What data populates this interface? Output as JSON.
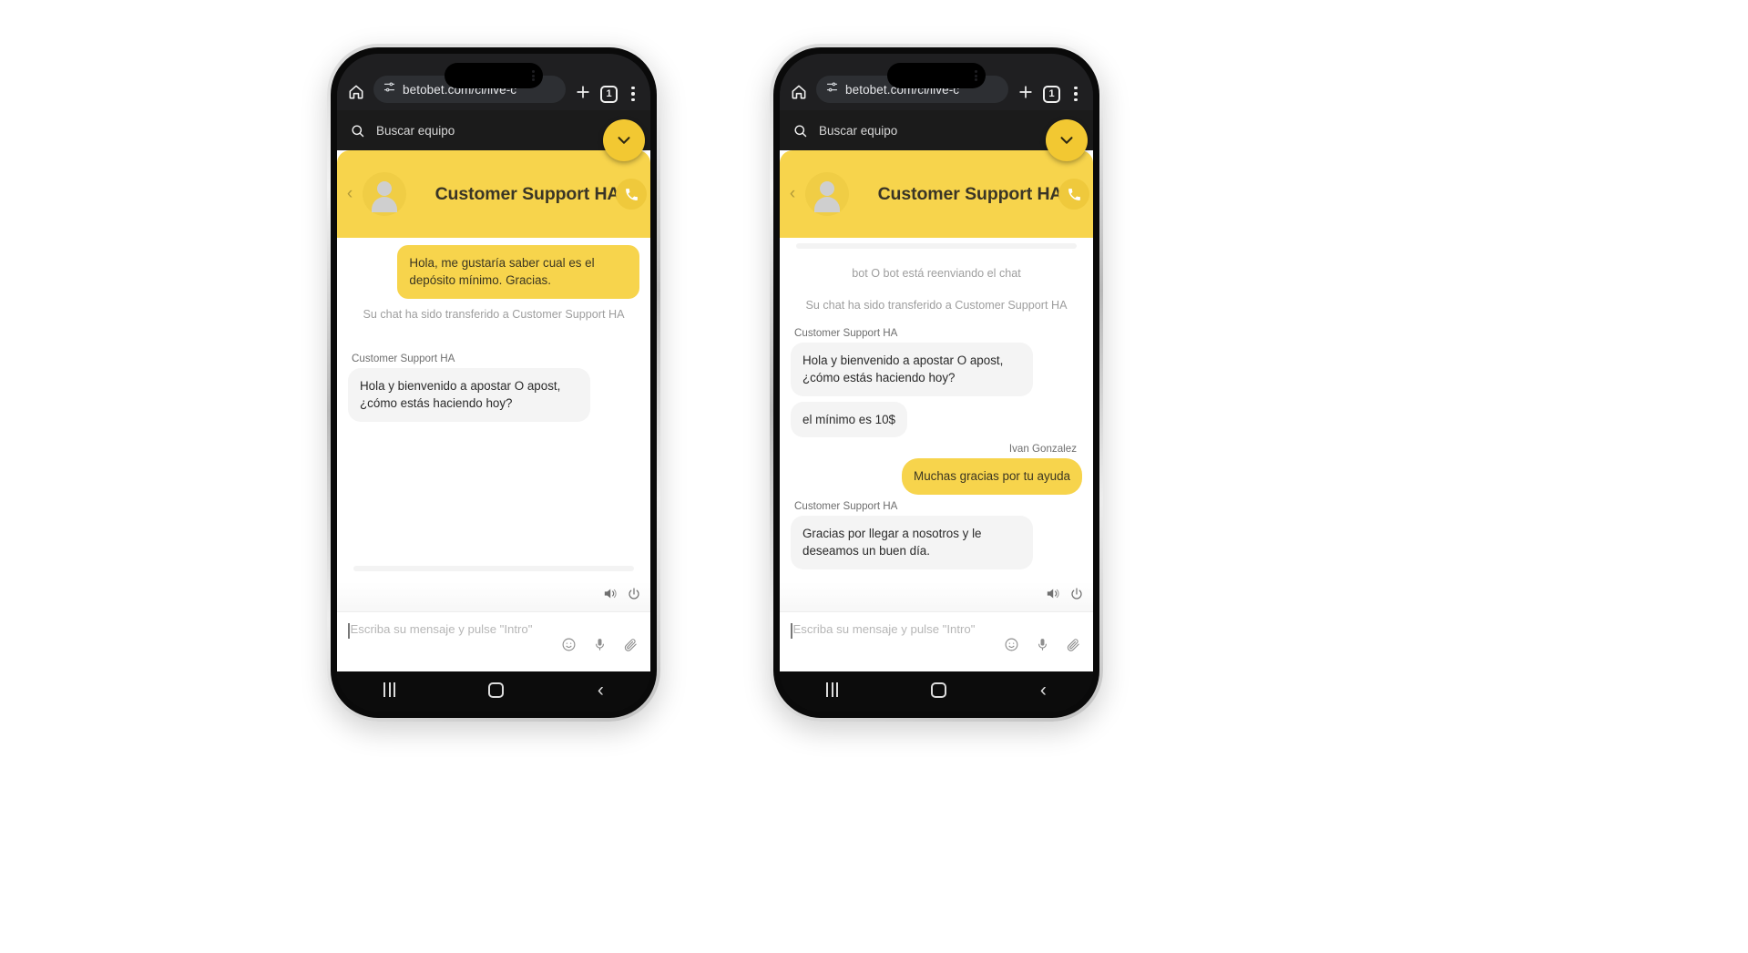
{
  "meta": {
    "accent_yellow": "#F7D44C",
    "fab_yellow": "#F2C832",
    "browser_dark": "#1f1f21",
    "search_dark": "#1b1b1b",
    "agent_bubble": "#f4f4f4"
  },
  "browser": {
    "url": "betobet.com/cl/live-c",
    "home_icon": "home-icon",
    "site_settings_icon": "tune-icon",
    "new_tab_label": "+",
    "tab_count": "1",
    "menu_icon": "kebab-menu-icon"
  },
  "site_search": {
    "icon": "search-icon",
    "placeholder": "Buscar equipo",
    "fab_icon": "chevron-down-icon"
  },
  "chat": {
    "back_icon": "chevron-left-icon",
    "avatar": "user-avatar-icon",
    "title": "Customer Support HA",
    "call_icon": "phone-icon",
    "controls": {
      "sound_icon": "speaker-icon",
      "power_icon": "power-icon"
    },
    "input": {
      "placeholder": "Escriba su mensaje y pulse \"Intro\"",
      "emoji_icon": "emoji-icon",
      "mic_icon": "microphone-icon",
      "attach_icon": "paperclip-icon"
    }
  },
  "left_phone": {
    "messages": [
      {
        "kind": "user",
        "text": "Hola, me gustaría saber cual es el depósito mínimo. Gracias."
      },
      {
        "kind": "system",
        "text": "Su chat ha sido transferido a Customer Support HA"
      },
      {
        "kind": "sender",
        "text": "Customer Support HA"
      },
      {
        "kind": "agent",
        "text": "Hola y bienvenido a apostar O apost, ¿cómo estás haciendo hoy?"
      }
    ]
  },
  "right_phone": {
    "messages": [
      {
        "kind": "system",
        "text": "bot O bot está reenviando el chat"
      },
      {
        "kind": "system",
        "text": "Su chat ha sido transferido a Customer Support HA"
      },
      {
        "kind": "sender",
        "text": "Customer Support HA"
      },
      {
        "kind": "agent",
        "text": "Hola y bienvenido a apostar O apost, ¿cómo estás haciendo hoy?"
      },
      {
        "kind": "agent",
        "text": "el mínimo es 10$"
      },
      {
        "kind": "sender_me",
        "text": "Ivan Gonzalez"
      },
      {
        "kind": "user",
        "text": "Muchas gracias por tu ayuda"
      },
      {
        "kind": "sender",
        "text": "Customer Support HA"
      },
      {
        "kind": "agent",
        "text": "Gracias por llegar a nosotros y le deseamos un buen día."
      }
    ]
  },
  "navbar": {
    "recent_icon": "recent-apps-icon",
    "home_icon": "home-square-icon",
    "back_icon": "back-chevron-icon"
  }
}
